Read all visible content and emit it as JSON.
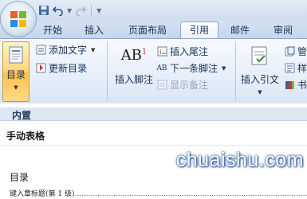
{
  "quick_access": {
    "save_icon": "save-icon",
    "undo_icon": "undo-icon",
    "redo_icon": "redo-icon"
  },
  "tabs": [
    {
      "label": "开始"
    },
    {
      "label": "插入"
    },
    {
      "label": "页面布局"
    },
    {
      "label": "引用",
      "active": true
    },
    {
      "label": "邮件"
    },
    {
      "label": "审阅"
    }
  ],
  "ribbon": {
    "toc": {
      "big_label": "目录",
      "add_text": "添加文字",
      "update_toc": "更新目录"
    },
    "footnotes": {
      "insert_footnote": "插入脚注",
      "footnote_glyph": "AB",
      "footnote_sup": "1",
      "insert_endnote": "插入尾注",
      "next_footnote": "下一条脚注",
      "show_notes": "显示备注"
    },
    "citations": {
      "insert_citation": "插入引文",
      "manage_partial": "管",
      "style_partial": "样",
      "bibliography_partial": "书"
    }
  },
  "dropdown": {
    "section_header": "内置",
    "manual_table": "手动表格",
    "preview_title": "目录",
    "preview_entry": "键入章标题(第 1 级)",
    "preview_dots": "..............................................................................................................."
  },
  "watermark": "chuaishu.com",
  "colors": {
    "accent": "#2b4f86",
    "active_button": "#ffd982",
    "ribbon_bg": "#e6eef9",
    "header_bg": "#dde6f2"
  }
}
